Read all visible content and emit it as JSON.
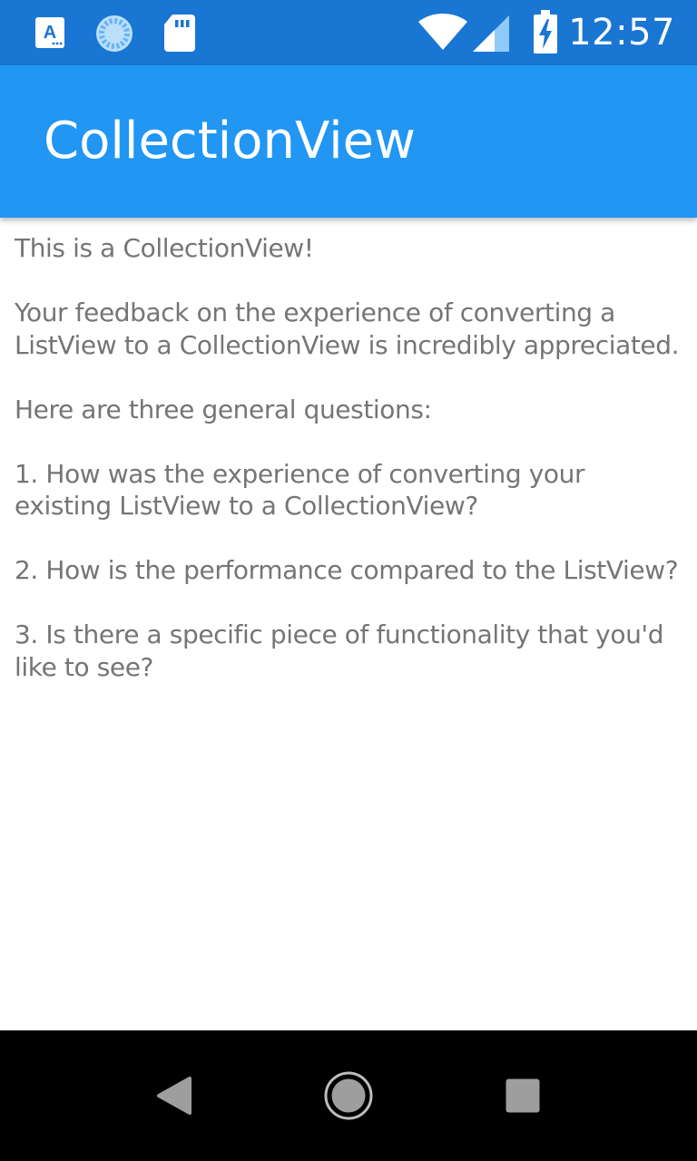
{
  "status_bar": {
    "time": "12:57",
    "background": "#1976D2",
    "icons": [
      "a-notification-icon",
      "sync-icon",
      "sd-card-icon",
      "wifi-icon",
      "cell-signal-icon",
      "battery-charging-icon"
    ]
  },
  "app_bar": {
    "title": "CollectionView",
    "background": "#2196F3"
  },
  "content": {
    "text_color": "#757575",
    "paragraphs": [
      "This is a CollectionView!",
      "Your feedback on the experience of converting a ListView to a CollectionView is incredibly appreciated.",
      "Here are three general questions:",
      "1. How was the experience of converting your existing ListView to a CollectionView?",
      "2. How is the performance compared to the ListView?",
      "3. Is there a specific piece of functionality that you'd like to see?"
    ]
  },
  "nav_bar": {
    "background": "#000000",
    "buttons": [
      "back-icon",
      "home-icon",
      "recents-icon"
    ]
  }
}
